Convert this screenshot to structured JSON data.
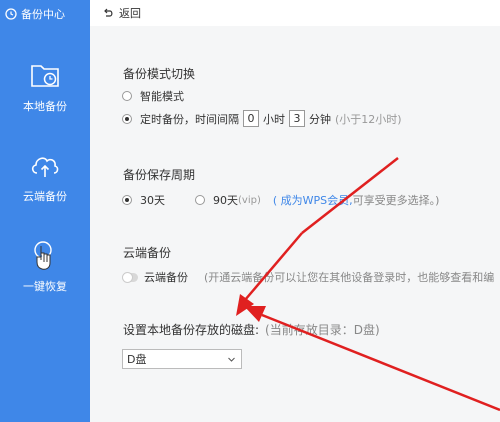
{
  "sidebar": {
    "title": "备份中心",
    "items": [
      {
        "label": "本地备份",
        "icon": "folder-clock-icon"
      },
      {
        "label": "云端备份",
        "icon": "cloud-upload-icon"
      },
      {
        "label": "一键恢复",
        "icon": "hand-pointer-icon"
      }
    ]
  },
  "topbar": {
    "back_label": "返回"
  },
  "mode": {
    "title": "备份模式切换",
    "smart_label": "智能模式",
    "scheduled_prefix": "定时备份，时间间隔",
    "hours_value": "0",
    "hours_unit": "小时",
    "minutes_value": "3",
    "minutes_unit": "分钟",
    "hint": "(小于12小时)"
  },
  "retention": {
    "title": "备份保存周期",
    "option_30": "30天",
    "option_90": "90天",
    "vip_tag": "(vip)",
    "link_text": "( 成为WPS会员,",
    "after_link": "可享受更多选择。)"
  },
  "cloud": {
    "title": "云端备份",
    "toggle_label": "云端备份",
    "description": "(开通云端备份可以让您在其他设备登录时，也能够查看和编"
  },
  "disk": {
    "title": "设置本地备份存放的磁盘:",
    "current": "(当前存放目录：D盘)",
    "selected": "D盘"
  },
  "colors": {
    "accent": "#3f87e8",
    "arrow": "#e02020"
  }
}
